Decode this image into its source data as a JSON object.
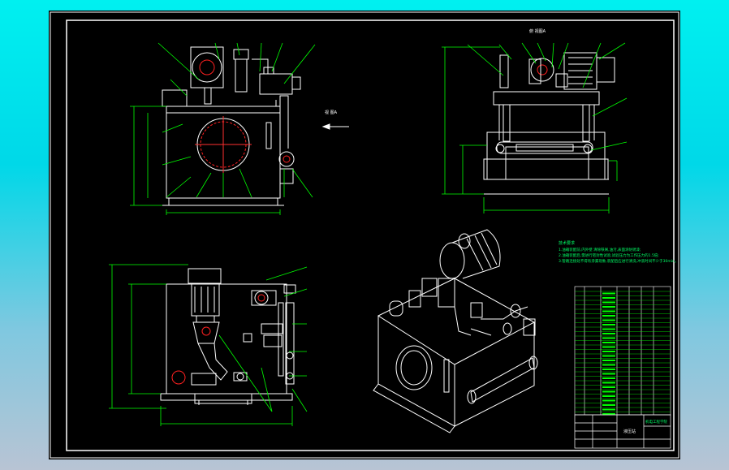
{
  "drawing": {
    "view_labels": [
      "俯 视图A",
      "视 图A"
    ],
    "technical_requirements": {
      "title": "技术要求",
      "lines": [
        "1.油箱装配前,内外壁 清除铁屑,油污,表面涂防锈漆;",
        "2.油箱装配后,需进行密封性试验,试验压力为工作压力的1.5倍;",
        "3.管路连接处不得有渗漏现象,装配后应进行清洗,冲洗时间不少于30min。"
      ]
    },
    "title_block": {
      "title": "液压站",
      "subtitle": "机电工程学院"
    },
    "colors": {
      "sheet_background": "#000000",
      "outline": "#ffffff",
      "border": "#ffffff",
      "dimension": "#00ff00",
      "leader": "#00ff00",
      "centerline": "#ff3030",
      "annotation": "#00ff66",
      "hidden_red": "#ff2020"
    }
  }
}
